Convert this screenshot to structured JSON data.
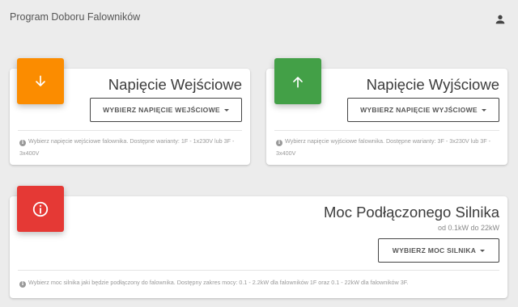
{
  "app": {
    "title": "Program Doboru Falowników"
  },
  "header": {
    "user_icon": "person-icon"
  },
  "cards": {
    "input": {
      "title": "Napięcie Wejściowe",
      "button_label": "WYBIERZ NAPIĘCIE WEJŚCIOWE",
      "hint": "Wybierz napięcie wejściowe falownika. Dostępne warianty: 1F - 1x230V lub 3F - 3x400V",
      "icon": "arrow-down-icon",
      "color": "#fb8c00"
    },
    "output": {
      "title": "Napięcie Wyjściowe",
      "button_label": "WYBIERZ NAPIĘCIE WYJŚCIOWE",
      "hint": "Wybierz napięcie wyjściowe falownika. Dostępne warianty: 3F - 3x230V lub 3F - 3x400V",
      "icon": "arrow-up-icon",
      "color": "#43a047"
    },
    "motor": {
      "title": "Moc Podłączonego Silnika",
      "subtitle": "od 0.1kW do 22kW",
      "button_label": "WYBIERZ MOC SILNIKA",
      "hint": "Wybierz moc silnika jaki będzie podłączony do falownika. Dostępny zakres mocy: 0.1 - 2.2kW dla falowników 1F oraz 0.1 - 22kW dla falowników 3F.",
      "icon": "info-icon",
      "color": "#e53935"
    }
  }
}
